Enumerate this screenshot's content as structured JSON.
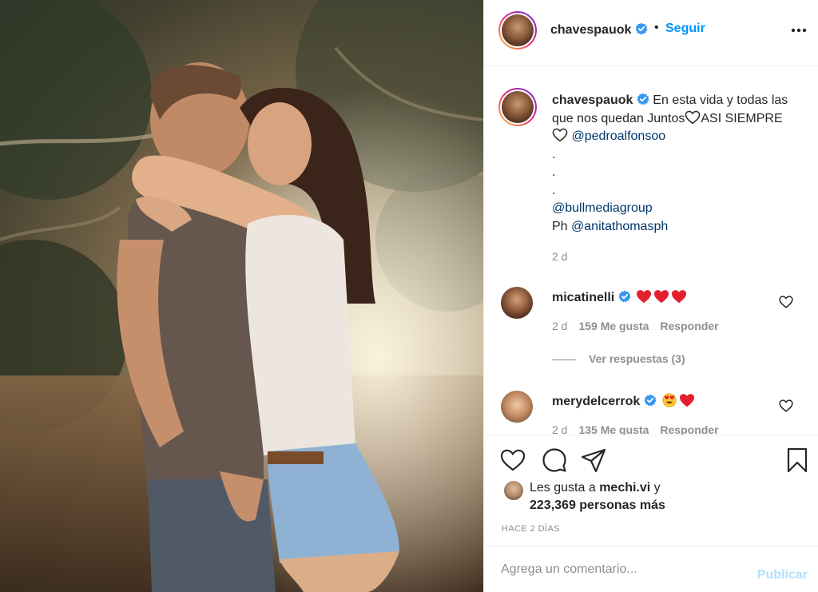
{
  "post": {
    "author": "chavespauok",
    "follow_label": "Seguir",
    "dot": "•",
    "caption": {
      "text_1": "En esta vida y todas las que nos quedan Juntos",
      "text_2": "ASI SIEMPRE",
      "mention_1": "@pedroalfonsoo",
      "dots": ".",
      "mention_2": "@bullmediagroup",
      "ph_prefix": "Ph",
      "mention_3": "@anitathomasph",
      "age": "2 d"
    }
  },
  "comments": [
    {
      "user": "micatinelli",
      "age": "2 d",
      "likes": "159 Me gusta",
      "reply": "Responder",
      "emoji": [
        "red-heart",
        "red-heart",
        "red-heart"
      ]
    },
    {
      "user": "merydelcerrok",
      "age": "2 d",
      "likes": "135 Me gusta",
      "reply": "Responder",
      "emoji": [
        "heart-eyes",
        "red-heart"
      ]
    }
  ],
  "view_replies": "Ver respuestas (3)",
  "likes": {
    "prefix": "Les gusta a",
    "user": "mechi.vi",
    "connector": "y",
    "count": "223,369 personas más"
  },
  "timestamp": "HACE 2 DÍAS",
  "add_comment": {
    "placeholder": "Agrega un comentario...",
    "publish": "Publicar"
  },
  "icons": {
    "verified": "verified-badge-icon",
    "more": "more-options-icon",
    "like": "heart-outline-icon",
    "comment": "comment-bubble-icon",
    "share": "paper-plane-icon",
    "save": "bookmark-icon"
  },
  "colors": {
    "accent": "#0095f6",
    "mention": "#00376b",
    "muted": "#8e8e8e",
    "publish_disabled": "#b2dffc",
    "heart": "#ed4956"
  }
}
